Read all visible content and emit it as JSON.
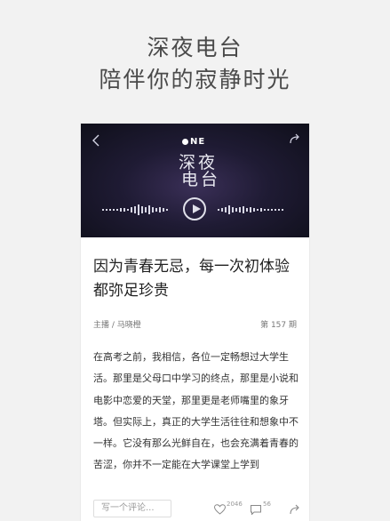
{
  "hero": {
    "line1": "深夜电台",
    "line2": "陪伴你的寂静时光"
  },
  "banner": {
    "brand": "NE",
    "logo_line1": "深夜",
    "logo_line2": "电台",
    "icons": [
      "back-chevron-icon",
      "share-icon",
      "play-icon"
    ]
  },
  "article": {
    "title": "因为青春无忌，每一次初体验都弥足珍贵",
    "host": "主播 / 马晓橙",
    "issue": "第 157 期",
    "body": "在高考之前，我相信，各位一定畅想过大学生活。那里是父母口中学习的终点，那里是小说和电影中恋爱的天堂，那里更是老师嘴里的象牙塔。但实际上，真正的大学生活往往和想象中不一样。它没有那么光鲜自在，也会充满着青春的苦涩，你并不一定能在大学课堂上学到"
  },
  "bottom_bar": {
    "comment_placeholder": "写一个评论...",
    "like_count": "2046",
    "comment_count": "56"
  },
  "colors": {
    "background": "#f2f2f2",
    "banner_dark": "#1f1b34",
    "banner_glow": "#3a2f57"
  }
}
